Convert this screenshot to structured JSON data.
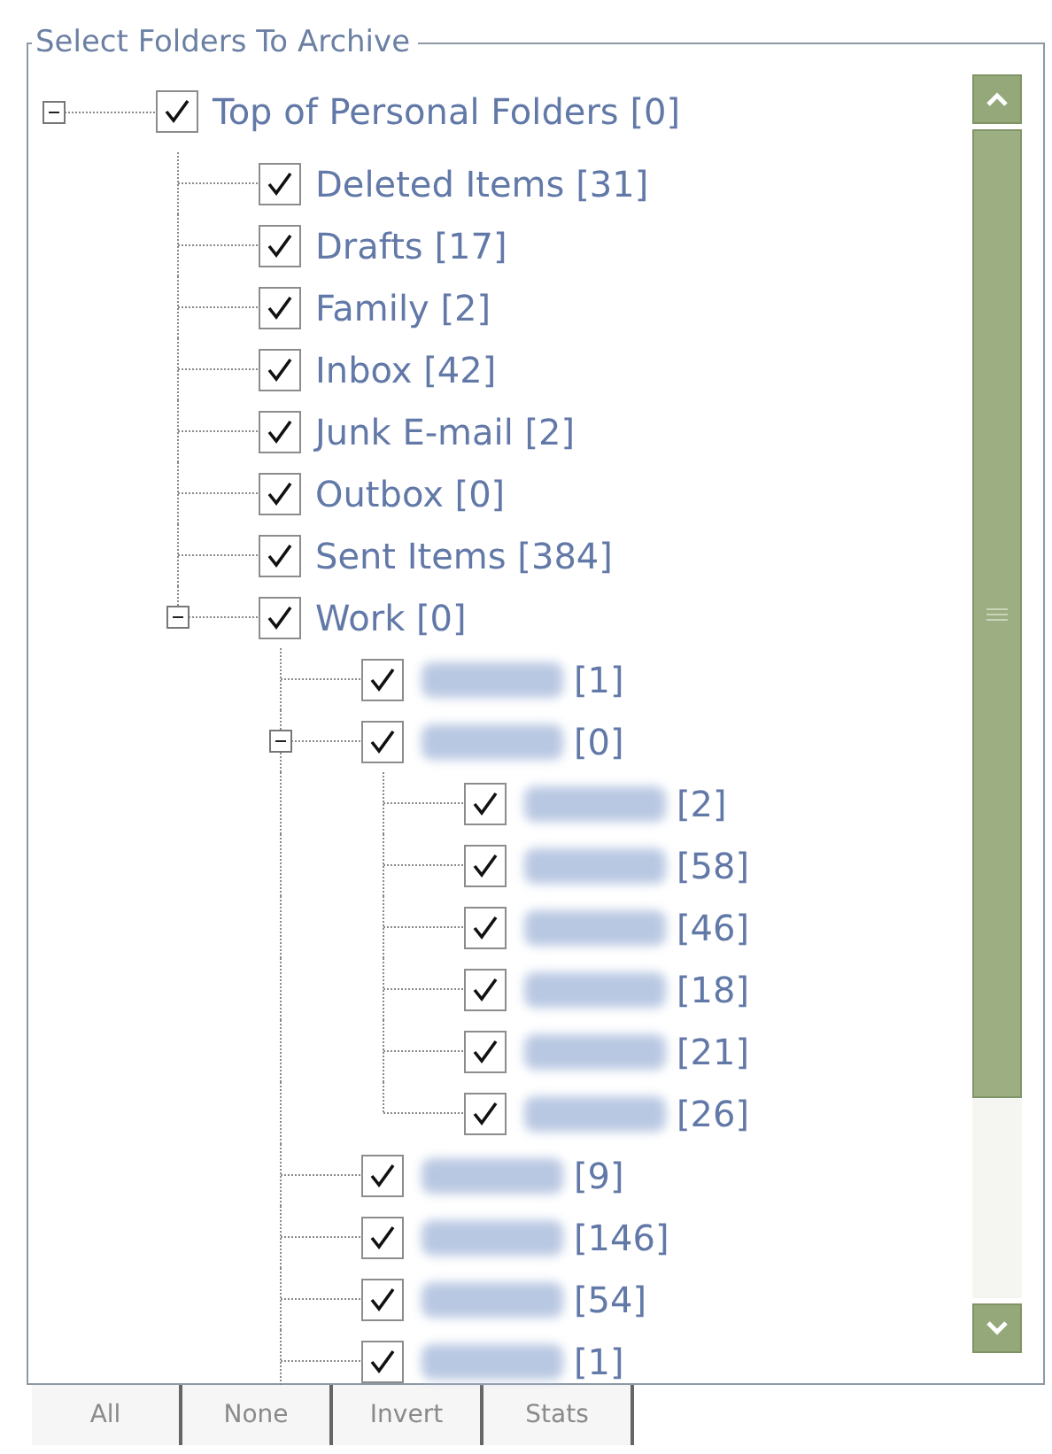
{
  "frame": {
    "title": "Select Folders To Archive"
  },
  "tree": [
    {
      "label": "Top of Personal Folders [0]",
      "checked": true,
      "expanded": true,
      "children": [
        {
          "label": "Deleted Items [31]",
          "checked": true
        },
        {
          "label": "Drafts [17]",
          "checked": true
        },
        {
          "label": "Family [2]",
          "checked": true
        },
        {
          "label": "Inbox [42]",
          "checked": true
        },
        {
          "label": "Junk E-mail [2]",
          "checked": true
        },
        {
          "label": "Outbox [0]",
          "checked": true
        },
        {
          "label": "Sent Items [384]",
          "checked": true
        },
        {
          "label": "Work [0]",
          "checked": true,
          "expanded": true,
          "more_below": true,
          "children": [
            {
              "label": "[1]",
              "redacted": true,
              "checked": true
            },
            {
              "label": "[0]",
              "redacted": true,
              "checked": true,
              "expanded": true,
              "children": [
                {
                  "label": "[2]",
                  "redacted": true,
                  "checked": true
                },
                {
                  "label": "[58]",
                  "redacted": true,
                  "checked": true
                },
                {
                  "label": "[46]",
                  "redacted": true,
                  "checked": true
                },
                {
                  "label": "[18]",
                  "redacted": true,
                  "checked": true
                },
                {
                  "label": "[21]",
                  "redacted": true,
                  "checked": true
                },
                {
                  "label": "[26]",
                  "redacted": true,
                  "checked": true
                }
              ]
            },
            {
              "label": "[9]",
              "redacted": true,
              "checked": true
            },
            {
              "label": "[146]",
              "redacted": true,
              "checked": true
            },
            {
              "label": "[54]",
              "redacted": true,
              "checked": true
            },
            {
              "label": "[1]",
              "redacted": true,
              "checked": true
            }
          ]
        }
      ]
    }
  ],
  "buttons": [
    {
      "label": "All"
    },
    {
      "label": "None"
    },
    {
      "label": "Invert"
    },
    {
      "label": "Stats"
    }
  ]
}
